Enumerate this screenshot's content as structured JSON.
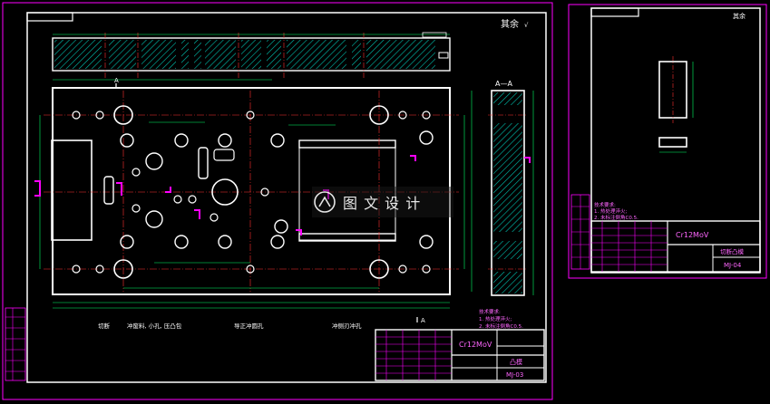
{
  "sheet1": {
    "surface_note": "其余",
    "section_label": "A—A",
    "section_marker": "A",
    "callouts": [
      "切断",
      "冲废料, 小孔, 压凸包",
      "导正冲圆孔",
      "冲侧刃冲孔"
    ],
    "tech_title": "技术要求:",
    "tech_lines": [
      "1. 热处理淬火;",
      "2. 未标注倒角C0.5."
    ],
    "title_block": {
      "material": "Cr12MoV",
      "part_name": "凸模",
      "drawing_no": "MJ-03"
    }
  },
  "sheet2": {
    "surface_note": "其余",
    "tech_title": "技术要求:",
    "tech_lines": [
      "1. 热处理淬火;",
      "2. 未标注倒角C0.5."
    ],
    "title_block": {
      "material": "Cr12MoV",
      "part_name": "切断凸模",
      "drawing_no": "MJ-04"
    }
  },
  "watermark": {
    "text": "图 文 设 计"
  },
  "colors": {
    "background": "#000000",
    "outline": "#ffffff",
    "frame": "#ff00ff",
    "centerline": "#ff3030",
    "dimension": "#00ff66",
    "title_text": "#ff66ff",
    "note_text": "#ffff00"
  }
}
